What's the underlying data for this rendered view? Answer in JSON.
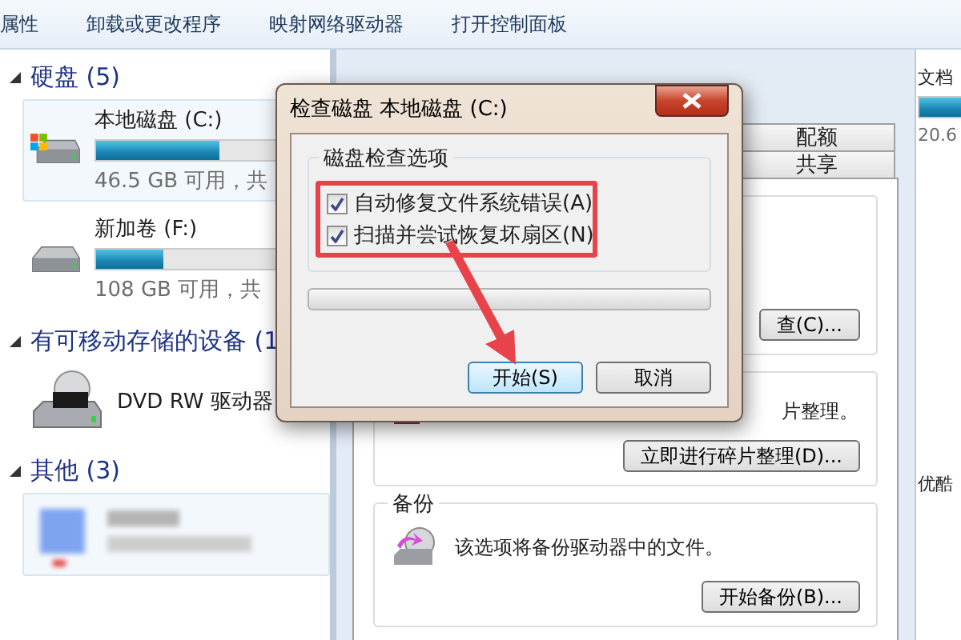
{
  "toolbar": {
    "items": [
      "属性",
      "卸载或更改程序",
      "映射网络驱动器",
      "打开控制面板"
    ]
  },
  "explorer": {
    "groups": [
      {
        "title": "硬盘 (5)",
        "items": [
          {
            "name": "本地磁盘 (C:)",
            "kind": "windows-disk",
            "level": 0.55,
            "space": "46.5 GB 可用，共",
            "selected": true
          },
          {
            "name": "新加卷 (F:)",
            "kind": "disk",
            "level": 0.3,
            "space": "108 GB 可用，共",
            "selected": false
          }
        ]
      },
      {
        "title": "有可移动存储的设备 (1",
        "items": [
          {
            "name": "DVD RW 驱动器",
            "kind": "dvd",
            "selected": false
          }
        ]
      },
      {
        "title": "其他 (3)",
        "items": [
          {
            "kind": "blurred",
            "selected": true
          }
        ]
      }
    ]
  },
  "properties": {
    "tab_rows": [
      [
        {
          "label": "配额",
          "selected": false
        }
      ],
      [
        {
          "label": "共享",
          "selected": false
        }
      ]
    ],
    "groups": [
      {
        "kind": "check",
        "button": "查(C)..."
      },
      {
        "kind": "defrag",
        "text": "片整理。",
        "button": "立即进行碎片整理(D)..."
      },
      {
        "kind": "backup",
        "title": "备份",
        "text": "该选项将备份驱动器中的文件。",
        "button": "开始备份(B)..."
      }
    ]
  },
  "right_column": {
    "name": "文档",
    "level": 0.8,
    "space": "20.6",
    "label_2": "优酷"
  },
  "dialog": {
    "title": "检查磁盘 本地磁盘 (C:)",
    "group_title": "磁盘检查选项",
    "options": [
      {
        "label": "自动修复文件系统错误(A)",
        "checked": true
      },
      {
        "label": "扫描并尝试恢复坏扇区(N)",
        "checked": true
      }
    ],
    "progress": {
      "level": 0
    },
    "buttons": [
      {
        "label": "开始(S)",
        "kind": "default"
      },
      {
        "label": "取消",
        "kind": "normal"
      }
    ]
  }
}
